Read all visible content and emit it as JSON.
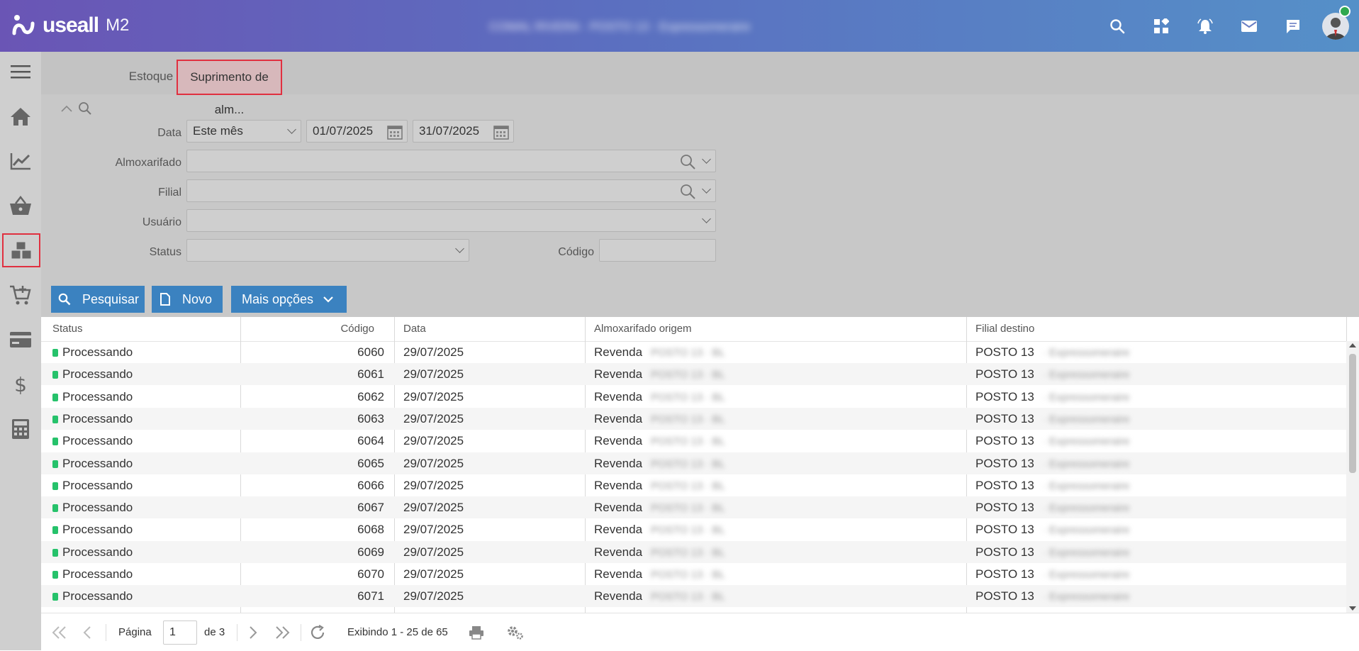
{
  "app": {
    "logo_text": "useall",
    "logo_version": "M2",
    "header_title_blurred": "COMAL RIVERA · POSTO 13 · Expressomeraire"
  },
  "colors": {
    "brand_gradient_start": "#6a55b5",
    "brand_gradient_end": "#5590c8",
    "primary_button": "#3b82c0",
    "active_highlight": "#e03040",
    "status_processing": "#26c26b"
  },
  "top_icons": [
    "search-icon",
    "apps-grid-icon",
    "notification-bell-icon",
    "mail-icon",
    "chat-icon",
    "user-avatar"
  ],
  "sidebar": {
    "items": [
      "menu-hamburger-icon",
      "home-icon",
      "chart-trend-icon",
      "basket-icon",
      "boxes-stock-icon",
      "cart-add-icon",
      "credit-card-icon",
      "dollar-icon",
      "calculator-icon"
    ],
    "active_index": 4
  },
  "tabs": [
    {
      "label": "Estoque"
    },
    {
      "label": "Suprimento de alm..."
    }
  ],
  "filters": {
    "data_label": "Data",
    "data_period": "Este mês",
    "date_from": "01/07/2025",
    "date_to": "31/07/2025",
    "almoxarifado_label": "Almoxarifado",
    "almoxarifado_value": "",
    "filial_label": "Filial",
    "filial_value": "",
    "usuario_label": "Usuário",
    "usuario_value": "",
    "status_label": "Status",
    "status_value": "",
    "codigo_label": "Código",
    "codigo_value": ""
  },
  "buttons": {
    "search": "Pesquisar",
    "new": "Novo",
    "more": "Mais opções"
  },
  "grid": {
    "columns": [
      "Status",
      "Código",
      "Data",
      "Almoxarifado origem",
      "Filial destino"
    ],
    "rows": [
      {
        "status": "Processando",
        "codigo": "6060",
        "data": "29/07/2025",
        "origem": "Revenda",
        "origem_blur": "POSTO 13 · BL",
        "destino": "POSTO 13",
        "destino_blur": "· Expressomeraire"
      },
      {
        "status": "Processando",
        "codigo": "6061",
        "data": "29/07/2025",
        "origem": "Revenda",
        "origem_blur": "POSTO 13 · BL",
        "destino": "POSTO 13",
        "destino_blur": "· Expressomeraire"
      },
      {
        "status": "Processando",
        "codigo": "6062",
        "data": "29/07/2025",
        "origem": "Revenda",
        "origem_blur": "POSTO 13 · BL",
        "destino": "POSTO 13",
        "destino_blur": "· Expressomeraire"
      },
      {
        "status": "Processando",
        "codigo": "6063",
        "data": "29/07/2025",
        "origem": "Revenda",
        "origem_blur": "POSTO 13 · BL",
        "destino": "POSTO 13",
        "destino_blur": "· Expressomeraire"
      },
      {
        "status": "Processando",
        "codigo": "6064",
        "data": "29/07/2025",
        "origem": "Revenda",
        "origem_blur": "POSTO 13 · BL",
        "destino": "POSTO 13",
        "destino_blur": "· Expressomeraire"
      },
      {
        "status": "Processando",
        "codigo": "6065",
        "data": "29/07/2025",
        "origem": "Revenda",
        "origem_blur": "POSTO 13 · BL",
        "destino": "POSTO 13",
        "destino_blur": "· Expressomeraire"
      },
      {
        "status": "Processando",
        "codigo": "6066",
        "data": "29/07/2025",
        "origem": "Revenda",
        "origem_blur": "POSTO 13 · BL",
        "destino": "POSTO 13",
        "destino_blur": "· Expressomeraire"
      },
      {
        "status": "Processando",
        "codigo": "6067",
        "data": "29/07/2025",
        "origem": "Revenda",
        "origem_blur": "POSTO 13 · BL",
        "destino": "POSTO 13",
        "destino_blur": "· Expressomeraire"
      },
      {
        "status": "Processando",
        "codigo": "6068",
        "data": "29/07/2025",
        "origem": "Revenda",
        "origem_blur": "POSTO 13 · BL",
        "destino": "POSTO 13",
        "destino_blur": "· Expressomeraire"
      },
      {
        "status": "Processando",
        "codigo": "6069",
        "data": "29/07/2025",
        "origem": "Revenda",
        "origem_blur": "POSTO 13 · BL",
        "destino": "POSTO 13",
        "destino_blur": "· Expressomeraire"
      },
      {
        "status": "Processando",
        "codigo": "6070",
        "data": "29/07/2025",
        "origem": "Revenda",
        "origem_blur": "POSTO 13 · BL",
        "destino": "POSTO 13",
        "destino_blur": "· Expressomeraire"
      },
      {
        "status": "Processando",
        "codigo": "6071",
        "data": "29/07/2025",
        "origem": "Revenda",
        "origem_blur": "POSTO 13 · BL",
        "destino": "POSTO 13",
        "destino_blur": "· Expressomeraire"
      }
    ]
  },
  "pager": {
    "page_label": "Página",
    "page_value": "1",
    "page_total": "de 3",
    "showing": "Exibindo 1 - 25 de 65"
  }
}
